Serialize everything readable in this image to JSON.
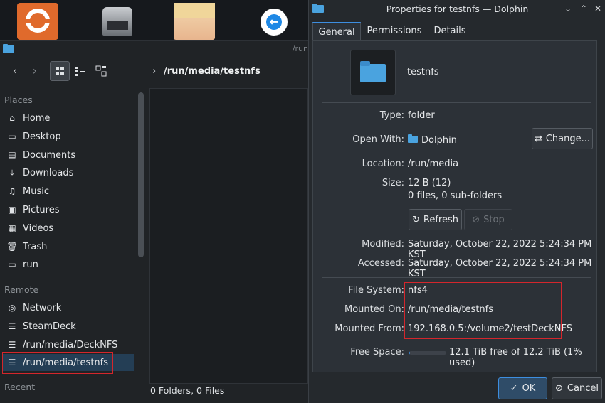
{
  "dolphin": {
    "path_truncated": "/run",
    "breadcrumb": "/run/media/testnfs",
    "sections": [
      "Places",
      "Remote",
      "Recent"
    ],
    "places": [
      "Home",
      "Desktop",
      "Documents",
      "Downloads",
      "Music",
      "Pictures",
      "Videos",
      "Trash",
      "run"
    ],
    "remote": [
      "Network",
      "SteamDeck",
      "/run/media/DeckNFS",
      "/run/media/testnfs"
    ],
    "status": "0 Folders, 0 Files"
  },
  "dialog": {
    "title": "Properties for testnfs — Dolphin",
    "tabs": [
      "General",
      "Permissions",
      "Details"
    ],
    "name": "testnfs",
    "type_label": "Type:",
    "type_value": "folder",
    "openwith_label": "Open With:",
    "openwith_value": "Dolphin",
    "change_button": "Change...",
    "location_label": "Location:",
    "location_value": "/run/media",
    "size_label": "Size:",
    "size_value": "12 B (12)",
    "size_detail": "0 files, 0 sub-folders",
    "refresh_button": "Refresh",
    "stop_button": "Stop",
    "modified_label": "Modified:",
    "modified_value": "Saturday, October 22, 2022 5:24:34 PM KST",
    "accessed_label": "Accessed:",
    "accessed_value": "Saturday, October 22, 2022 5:24:34 PM KST",
    "fs_label": "File System:",
    "fs_value": "nfs4",
    "mounted_on_label": "Mounted On:",
    "mounted_on_value": "/run/media/testnfs",
    "mounted_from_label": "Mounted From:",
    "mounted_from_value": "192.168.0.5:/volume2/testDeckNFS",
    "free_label": "Free Space:",
    "free_value": "12.1 TiB free of 12.2 TiB (1% used)",
    "used_fraction": 0.01,
    "ok_button": "OK",
    "cancel_button": "Cancel"
  },
  "colors": {
    "accent": "#3d8ee0",
    "highlight_box": "#d4262c",
    "folder": "#4aa3df"
  }
}
